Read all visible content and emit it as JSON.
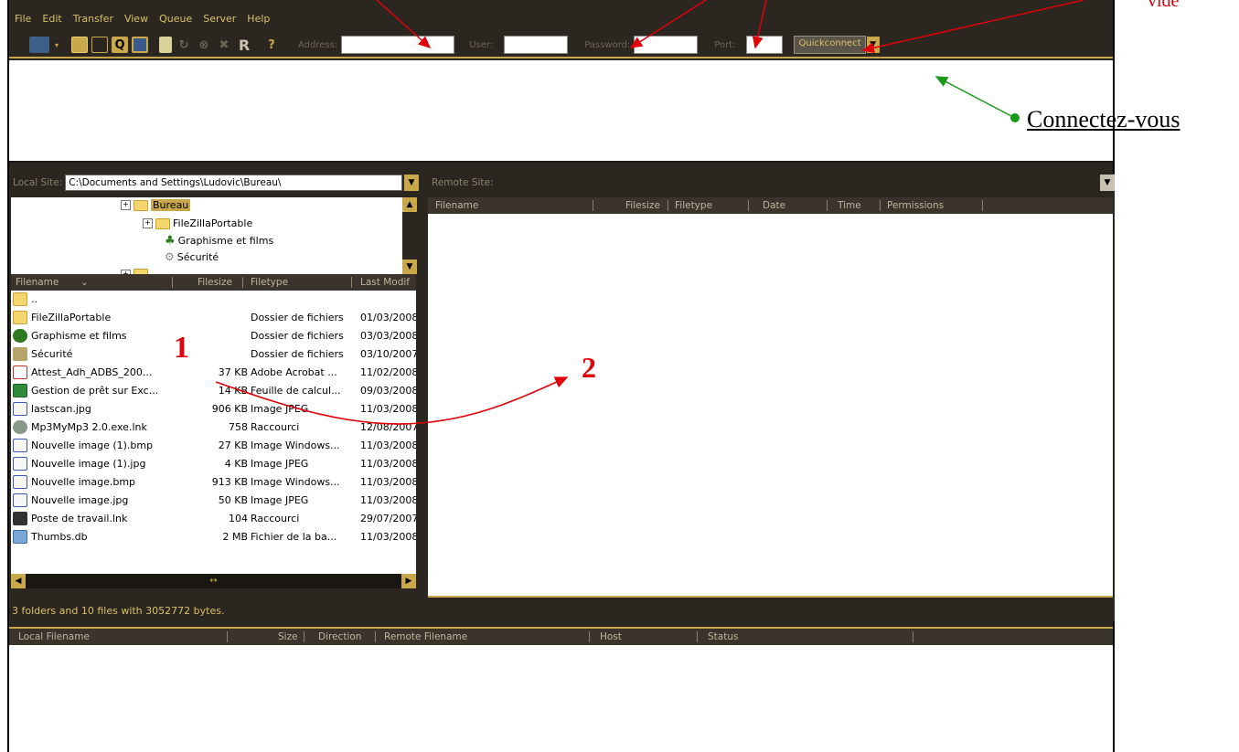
{
  "menu": [
    "File",
    "Edit",
    "Transfer",
    "View",
    "Queue",
    "Server",
    "Help"
  ],
  "toolbar": {
    "address_label": "Address:",
    "user_label": "User:",
    "password_label": "Password:",
    "port_label": "Port:",
    "quickconnect": "Quickconnect",
    "r_label": "R",
    "q_label": "Q",
    "help_label": "?"
  },
  "local": {
    "label": "Local Site:",
    "path": "C:\\Documents and Settings\\Ludovic\\Bureau\\",
    "tree": [
      "Bureau",
      "FileZillaPortable",
      "Graphisme et films",
      "Sécurité"
    ],
    "columns": [
      "Filename",
      "Filesize",
      "Filetype",
      "Last Modif"
    ],
    "files": [
      {
        "name": "..",
        "size": "",
        "type": "",
        "date": "",
        "icon": "folder"
      },
      {
        "name": "FileZillaPortable",
        "size": "",
        "type": "Dossier de fichiers",
        "date": "01/03/2008",
        "icon": "folder"
      },
      {
        "name": "Graphisme et films",
        "size": "",
        "type": "Dossier de fichiers",
        "date": "03/03/2008",
        "icon": "tree"
      },
      {
        "name": "Sécurité",
        "size": "",
        "type": "Dossier de fichiers",
        "date": "03/10/2007",
        "icon": "shortcut"
      },
      {
        "name": "Attest_Adh_ADBS_200...",
        "size": "37 KB",
        "type": "Adobe Acrobat ...",
        "date": "11/02/2008",
        "icon": "pdf"
      },
      {
        "name": "Gestion de prêt sur Exc...",
        "size": "14 KB",
        "type": "Feuille de calcul...",
        "date": "09/03/2008",
        "icon": "excel"
      },
      {
        "name": "lastscan.jpg",
        "size": "906 KB",
        "type": "Image JPEG",
        "date": "11/03/2008",
        "icon": "image"
      },
      {
        "name": "Mp3MyMp3 2.0.exe.lnk",
        "size": "758",
        "type": "Raccourci",
        "date": "12/08/2007",
        "icon": "app"
      },
      {
        "name": "Nouvelle image (1).bmp",
        "size": "27 KB",
        "type": "Image Windows...",
        "date": "11/03/2008",
        "icon": "image"
      },
      {
        "name": "Nouvelle image (1).jpg",
        "size": "4 KB",
        "type": "Image JPEG",
        "date": "11/03/2008",
        "icon": "image"
      },
      {
        "name": "Nouvelle image.bmp",
        "size": "913 KB",
        "type": "Image Windows...",
        "date": "11/03/2008",
        "icon": "image"
      },
      {
        "name": "Nouvelle image.jpg",
        "size": "50 KB",
        "type": "Image JPEG",
        "date": "11/03/2008",
        "icon": "image"
      },
      {
        "name": "Poste de travail.lnk",
        "size": "104",
        "type": "Raccourci",
        "date": "29/07/2007",
        "icon": "computer"
      },
      {
        "name": "Thumbs.db",
        "size": "2 MB",
        "type": "Fichier de la ba...",
        "date": "11/03/2008",
        "icon": "db"
      }
    ],
    "status": "3 folders and 10 files with 3052772 bytes."
  },
  "remote": {
    "label": "Remote Site:",
    "columns": [
      "Filename",
      "Filesize",
      "Filetype",
      "Date",
      "Time",
      "Permissions"
    ]
  },
  "queue": {
    "columns": [
      "Local Filename",
      "Size",
      "Direction",
      "Remote Filename",
      "Host",
      "Status"
    ]
  },
  "annotations": {
    "vide": "vide",
    "connect": "Connectez-vous",
    "one": "1",
    "two": "2"
  },
  "colors": {
    "window_bg": "#2b2620",
    "accent": "#c9a84b",
    "menu_text": "#d9c06a",
    "annotation_red": "#e0000a",
    "annotation_green": "#1a9a1a"
  }
}
